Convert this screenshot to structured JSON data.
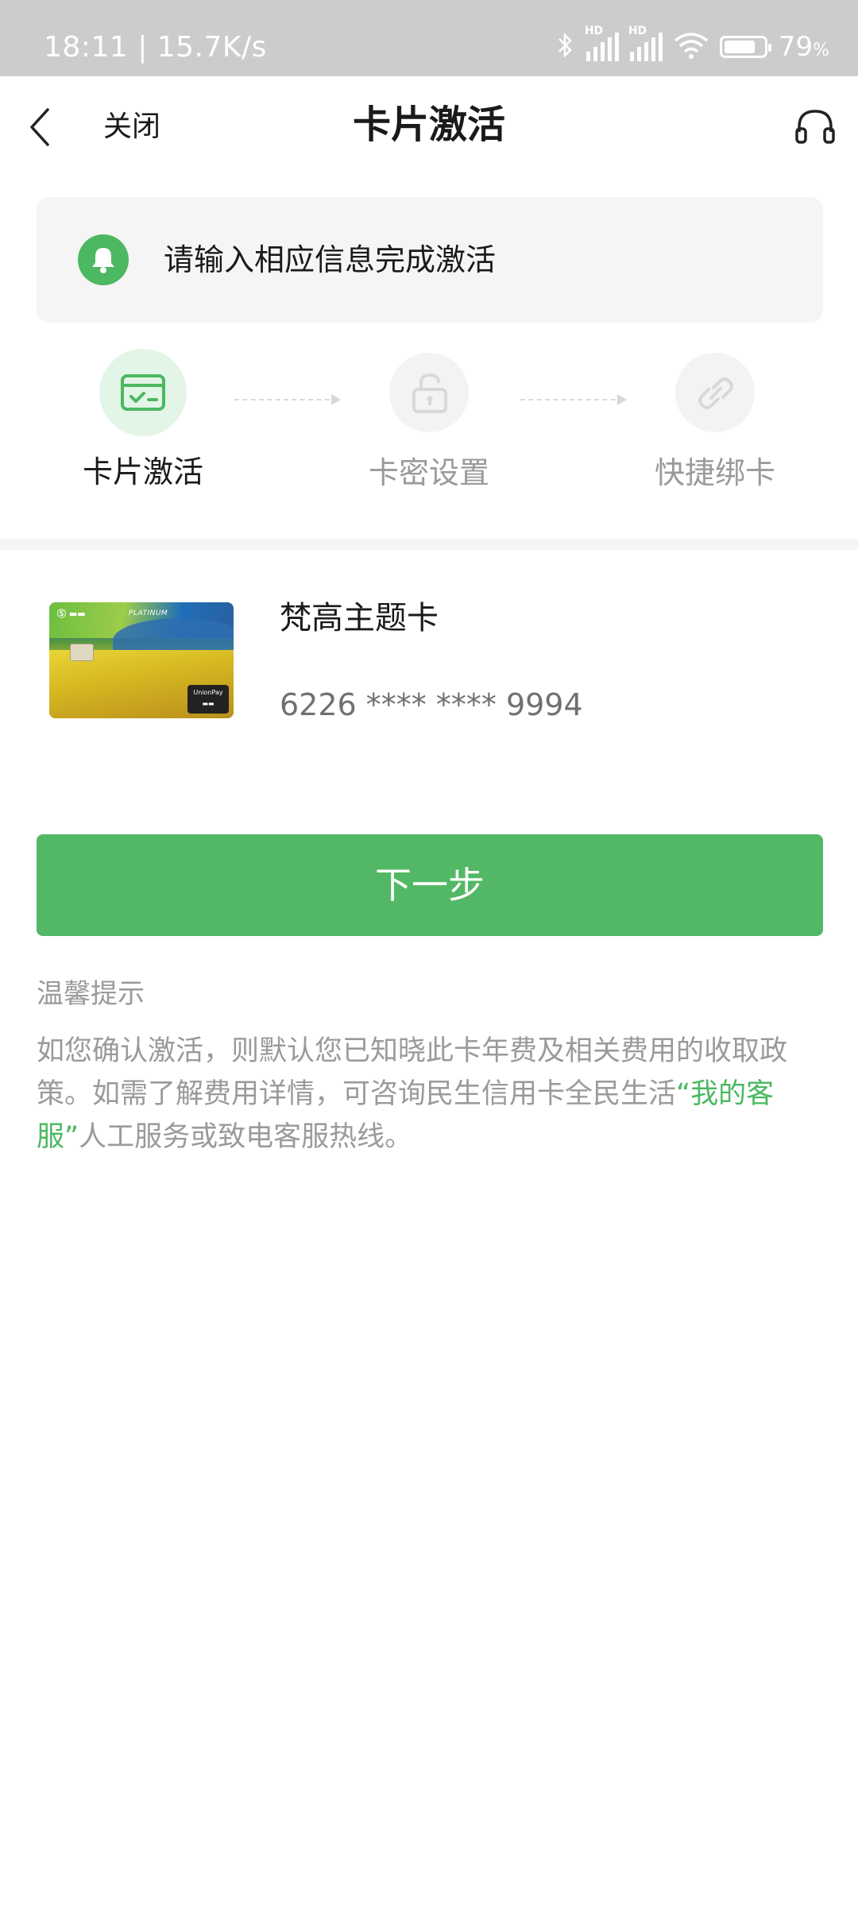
{
  "status_bar": {
    "time_speed": "18:11 | 15.7K/s",
    "battery_level": 0.79,
    "battery_percent": "79",
    "percent_sign": "%",
    "icons": [
      "bluetooth-icon",
      "signal-hd-icon",
      "signal-hd-icon",
      "wifi-icon",
      "battery-icon"
    ]
  },
  "header": {
    "close_label": "关闭",
    "title": "卡片激活",
    "icons": [
      "back-arrow-icon",
      "headset-icon"
    ]
  },
  "tip": {
    "text": "请输入相应信息完成激活",
    "icon": "bell-icon"
  },
  "steps": [
    {
      "label": "卡片激活",
      "icon": "card-check-icon",
      "active": true
    },
    {
      "label": "卡密设置",
      "icon": "lock-icon",
      "active": false
    },
    {
      "label": "快捷绑卡",
      "icon": "link-icon",
      "active": false
    }
  ],
  "card": {
    "name": "梵高主题卡",
    "number": "6226 **** **** 9994"
  },
  "next_button": "下一步",
  "notice": {
    "title": "温馨提示",
    "body_part1": "如您确认激活，则默认您已知晓此卡年费及相关费用的收取政策。如需了解费用详情，可咨询民生信用卡全民生活",
    "link_text": "“我的客服”",
    "body_part2": "人工服务或致电客服热线。"
  },
  "colors": {
    "accent": "#52b865",
    "status_bar_bg": "#cccccc",
    "muted_text": "#9a9a9a"
  }
}
